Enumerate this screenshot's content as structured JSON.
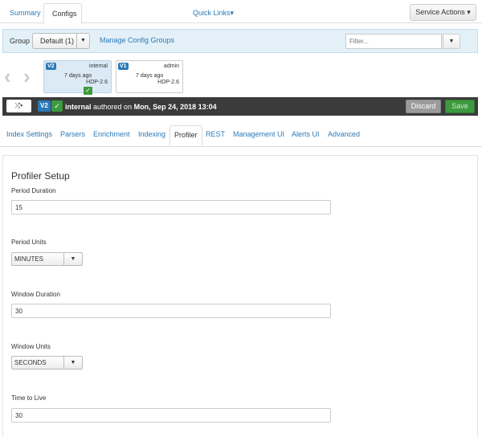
{
  "top_tabs": {
    "summary": "Summary",
    "configs": "Configs"
  },
  "quick_links": "Quick Links",
  "service_actions": "Service Actions",
  "group_bar": {
    "label": "Group",
    "selected": "Default (1)",
    "manage_link": "Manage Config Groups",
    "filter_placeholder": "Filter..."
  },
  "versions": [
    {
      "badge": "V2",
      "user": "internal",
      "time": "7 days ago",
      "stack": "HDP-2.6",
      "current": true
    },
    {
      "badge": "V1",
      "user": "admin",
      "time": "7 days ago",
      "stack": "HDP-2.6",
      "current": false
    }
  ],
  "version_bar": {
    "badge": "V2",
    "author": "internal",
    "authored_text": "authored on",
    "date": "Mon, Sep 24, 2018 13:04",
    "discard": "Discard",
    "save": "Save"
  },
  "sub_tabs": [
    "Index Settings",
    "Parsers",
    "Enrichment",
    "Indexing",
    "Profiler",
    "REST",
    "Management UI",
    "Alerts UI",
    "Advanced"
  ],
  "active_sub_tab": "Profiler",
  "profiler": {
    "title": "Profiler Setup",
    "period_duration_label": "Period Duration",
    "period_duration": "15",
    "period_units_label": "Period Units",
    "period_units": "MINUTES",
    "window_duration_label": "Window Duration",
    "window_duration": "30",
    "window_units_label": "Window Units",
    "window_units": "SECONDS",
    "ttl_label": "Time to Live",
    "ttl": "30"
  },
  "colors": {
    "link": "#2a7ab8",
    "version_badge": "#2a7ab8",
    "success": "#3e9a3e",
    "dark_bar": "#3b3b3b",
    "group_bar": "#e3f0f8"
  },
  "icons": {
    "dropdown": "caret-down-icon",
    "check": "check-icon",
    "shuffle": "shuffle-icon",
    "prev": "chevron-left-icon",
    "next": "chevron-right-icon"
  }
}
